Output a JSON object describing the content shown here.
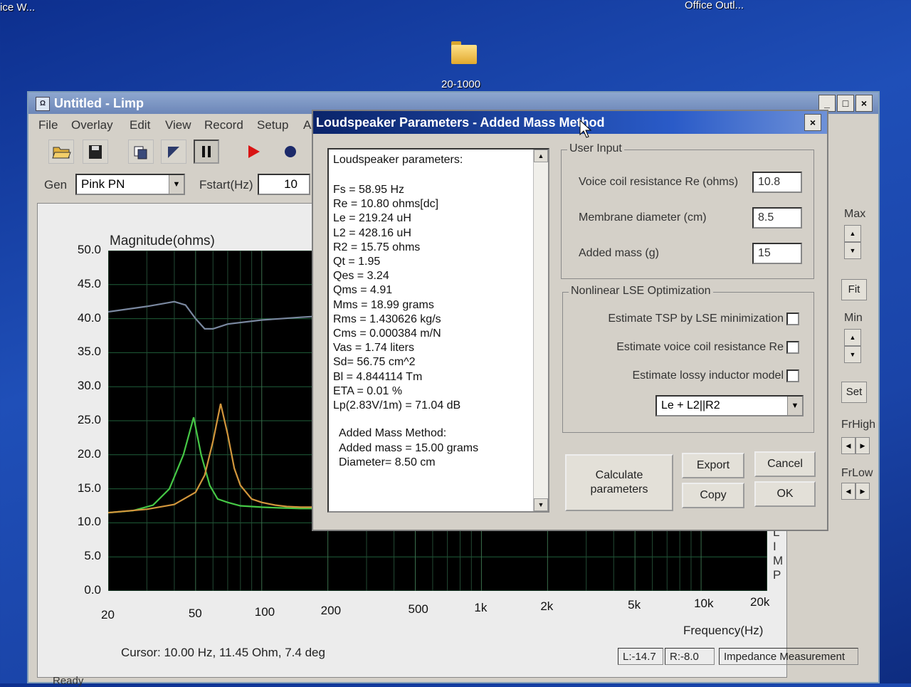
{
  "desktop": {
    "label_left": "ice W...",
    "label_right": "Office Outl...",
    "folder_label": "20-1000"
  },
  "window": {
    "title": "Untitled - Limp",
    "menu": [
      "File",
      "Overlay",
      "Edit",
      "View",
      "Record",
      "Setup",
      "A"
    ],
    "gen_label": "Gen",
    "gen_value": "Pink PN",
    "fstart_label": "Fstart(Hz)",
    "fstart_value": "10"
  },
  "plot": {
    "y_title": "Magnitude(ohms)",
    "x_title": "Frequency(Hz)",
    "side_label": [
      "L",
      "I",
      "M",
      "P"
    ],
    "cursor": "Cursor: 10.00 Hz, 11.45 Ohm, 7.4 deg",
    "status": [
      "L:-14.7",
      "R:-8.0",
      "Impedance Measurement"
    ],
    "ready": "Ready"
  },
  "side_controls": {
    "max": "Max",
    "fit": "Fit",
    "min": "Min",
    "set": "Set",
    "frhigh": "FrHigh",
    "frlow": "FrLow"
  },
  "chart_data": {
    "type": "line",
    "xscale": "log",
    "xlim": [
      20,
      20000
    ],
    "ylim": [
      0,
      50
    ],
    "xticks": [
      20,
      50,
      100,
      200,
      500,
      1000,
      2000,
      5000,
      10000,
      20000
    ],
    "xtick_labels": [
      "20",
      "50",
      "100",
      "200",
      "500",
      "1k",
      "2k",
      "5k",
      "10k",
      "20k"
    ],
    "yticks": [
      "0.0",
      "5.0",
      "10.0",
      "15.0",
      "20.0",
      "25.0",
      "30.0",
      "35.0",
      "40.0",
      "45.0",
      "50.0"
    ],
    "ylabel": "Magnitude(ohms)",
    "xlabel": "Frequency(Hz)",
    "grid": true,
    "series": [
      {
        "color": "#46c846",
        "x": [
          20,
          26,
          32,
          38,
          44,
          49,
          53,
          58,
          63,
          70,
          80,
          100,
          120,
          150,
          210
        ],
        "y": [
          11.5,
          11.8,
          12.6,
          15,
          20,
          25.5,
          20,
          15.5,
          13.5,
          13,
          12.5,
          12.3,
          12.2,
          12.1,
          12.1
        ]
      },
      {
        "color": "#d2963c",
        "x": [
          20,
          30,
          40,
          50,
          55,
          60,
          65,
          70,
          75,
          80,
          90,
          100,
          115,
          130,
          150,
          210
        ],
        "y": [
          11.5,
          12,
          12.7,
          14.5,
          17,
          22,
          27.5,
          23,
          18,
          15.5,
          13.5,
          13,
          12.6,
          12.4,
          12.3,
          12.3
        ]
      },
      {
        "color": "#7a88a0",
        "x": [
          20,
          30,
          40,
          45,
          50,
          55,
          60,
          70,
          100,
          150,
          210
        ],
        "y": [
          41,
          41.8,
          42.5,
          42,
          40,
          38.5,
          38.5,
          39.2,
          39.8,
          40.2,
          40.5
        ]
      }
    ]
  },
  "dialog": {
    "title": "Loudspeaker Parameters - Added Mass Method",
    "params_header": "Loudspeaker parameters:",
    "params": [
      "Fs  = 58.95 Hz",
      "Re  = 10.80 ohms[dc]",
      "Le  = 219.24 uH",
      "L2  = 428.16 uH",
      "R2  = 15.75 ohms",
      "Qt  = 1.95",
      "Qes = 3.24",
      "Qms = 4.91",
      "Mms = 18.99 grams",
      "Rms = 1.430626 kg/s",
      "Cms = 0.000384 m/N",
      "Vas = 1.74 liters",
      "Sd= 56.75 cm^2",
      "Bl  = 4.844114 Tm",
      "ETA = 0.01 %",
      "Lp(2.83V/1m) = 71.04 dB"
    ],
    "mass_lines": [
      "Added Mass Method:",
      "Added mass = 15.00 grams",
      "Diameter= 8.50 cm"
    ],
    "user_input": {
      "title": "User Input",
      "re_label": "Voice coil resistance Re (ohms)",
      "re_value": "10.8",
      "diam_label": "Membrane diameter (cm)",
      "diam_value": "8.5",
      "mass_label": "Added mass (g)",
      "mass_value": "15"
    },
    "lse": {
      "title": "Nonlinear LSE Optimization",
      "opt1": "Estimate TSP by LSE minimization",
      "opt2": "Estimate voice coil resistance Re",
      "opt3": "Estimate lossy inductor model",
      "model": "Le + L2||R2"
    },
    "buttons": {
      "calc_line1": "Calculate",
      "calc_line2": "parameters",
      "export": "Export",
      "cancel": "Cancel",
      "copy": "Copy",
      "ok": "OK"
    }
  }
}
